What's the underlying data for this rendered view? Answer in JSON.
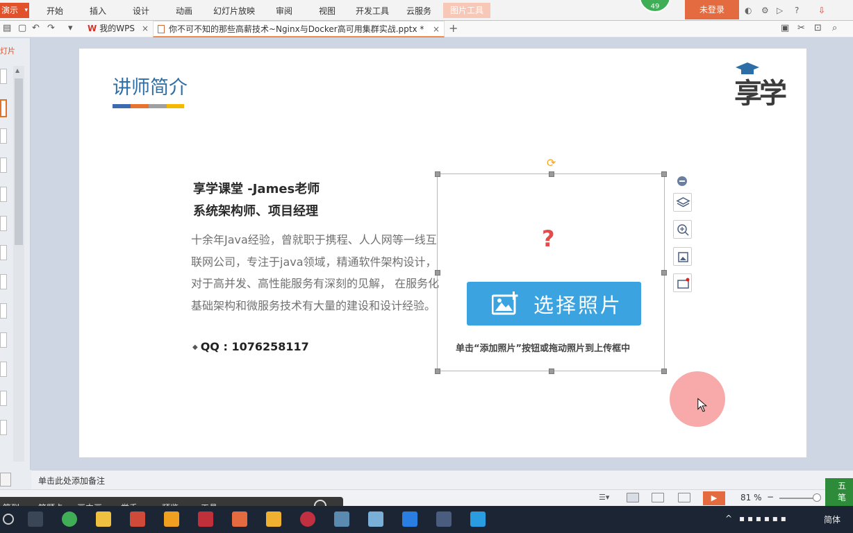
{
  "app": {
    "app_button_label": "演示",
    "menu": [
      "开始",
      "插入",
      "设计",
      "动画",
      "幻灯片放映",
      "审阅",
      "视图",
      "开发工具",
      "云服务"
    ],
    "picture_tools_label": "图片工具",
    "login_label": "未登录",
    "badge_count": "49",
    "help_label": "?"
  },
  "tabs": {
    "wps_tab_label": "我的WPS",
    "doc_tab_label": "你不可不知的那些高薪技术~Nginx与Docker高可用集群实战.pptx *",
    "close_glyph": "×",
    "add_glyph": "+"
  },
  "left_panel": {
    "label": "灯片"
  },
  "slide": {
    "title": "讲师简介",
    "bar_colors": [
      "#3c6bb0",
      "#e8732e",
      "#a0a0a0",
      "#f5b800"
    ],
    "logo_text": "享学",
    "name_line1": "享学课堂 -James老师",
    "name_line2": "系统架构师、项目经理",
    "bio": "十余年Java经验，曾就职于携程、人人网等一线互联网公司，专注于java领域，精通软件架构设计，对于高并发、高性能服务有深刻的见解， 在服务化基础架构和微服务技术有大量的建设和设计经验。",
    "qq_label": "QQ : 1076258117",
    "placeholder": {
      "question_mark": "?",
      "choose_label": "选择照片",
      "hint": "单击“添加照片”按钮或拖动照片到上传框中"
    },
    "accent_color": "#2e6ea6"
  },
  "notes": {
    "placeholder": "单击此处添加备注"
  },
  "statusbar": {
    "zoom": "81 %",
    "minus": "−"
  },
  "overlay": {
    "items": [
      "签到",
      "答题卡",
      "画中画",
      "举手",
      "预览",
      "工具"
    ]
  },
  "ime": {
    "label": "五笔"
  },
  "taskbar": {
    "lang": "简体"
  }
}
